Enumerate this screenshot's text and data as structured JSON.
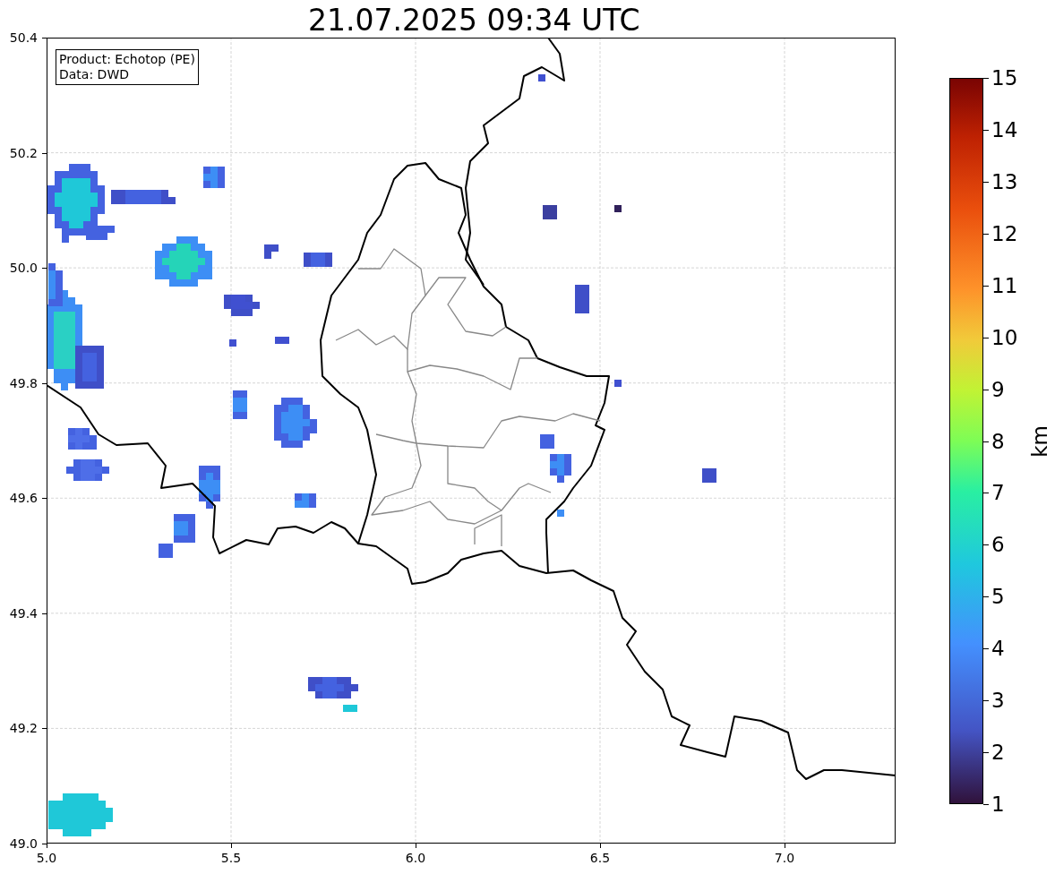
{
  "title": "21.07.2025 09:34 UTC",
  "map": {
    "legend": [
      "Product: Echotop (PE)",
      "Data: DWD"
    ],
    "x_ticks": [
      "5.0",
      "5.5",
      "6.0",
      "6.5",
      "7.0"
    ],
    "y_ticks": [
      "50.4",
      "50.2",
      "50.0",
      "49.8",
      "49.6",
      "49.4",
      "49.2",
      "49.0"
    ]
  },
  "colorbar": {
    "label": "km",
    "ticks": [
      "15",
      "14",
      "13",
      "12",
      "11",
      "10",
      "9",
      "8",
      "7",
      "6",
      "5",
      "4",
      "3",
      "2",
      "1"
    ]
  }
}
